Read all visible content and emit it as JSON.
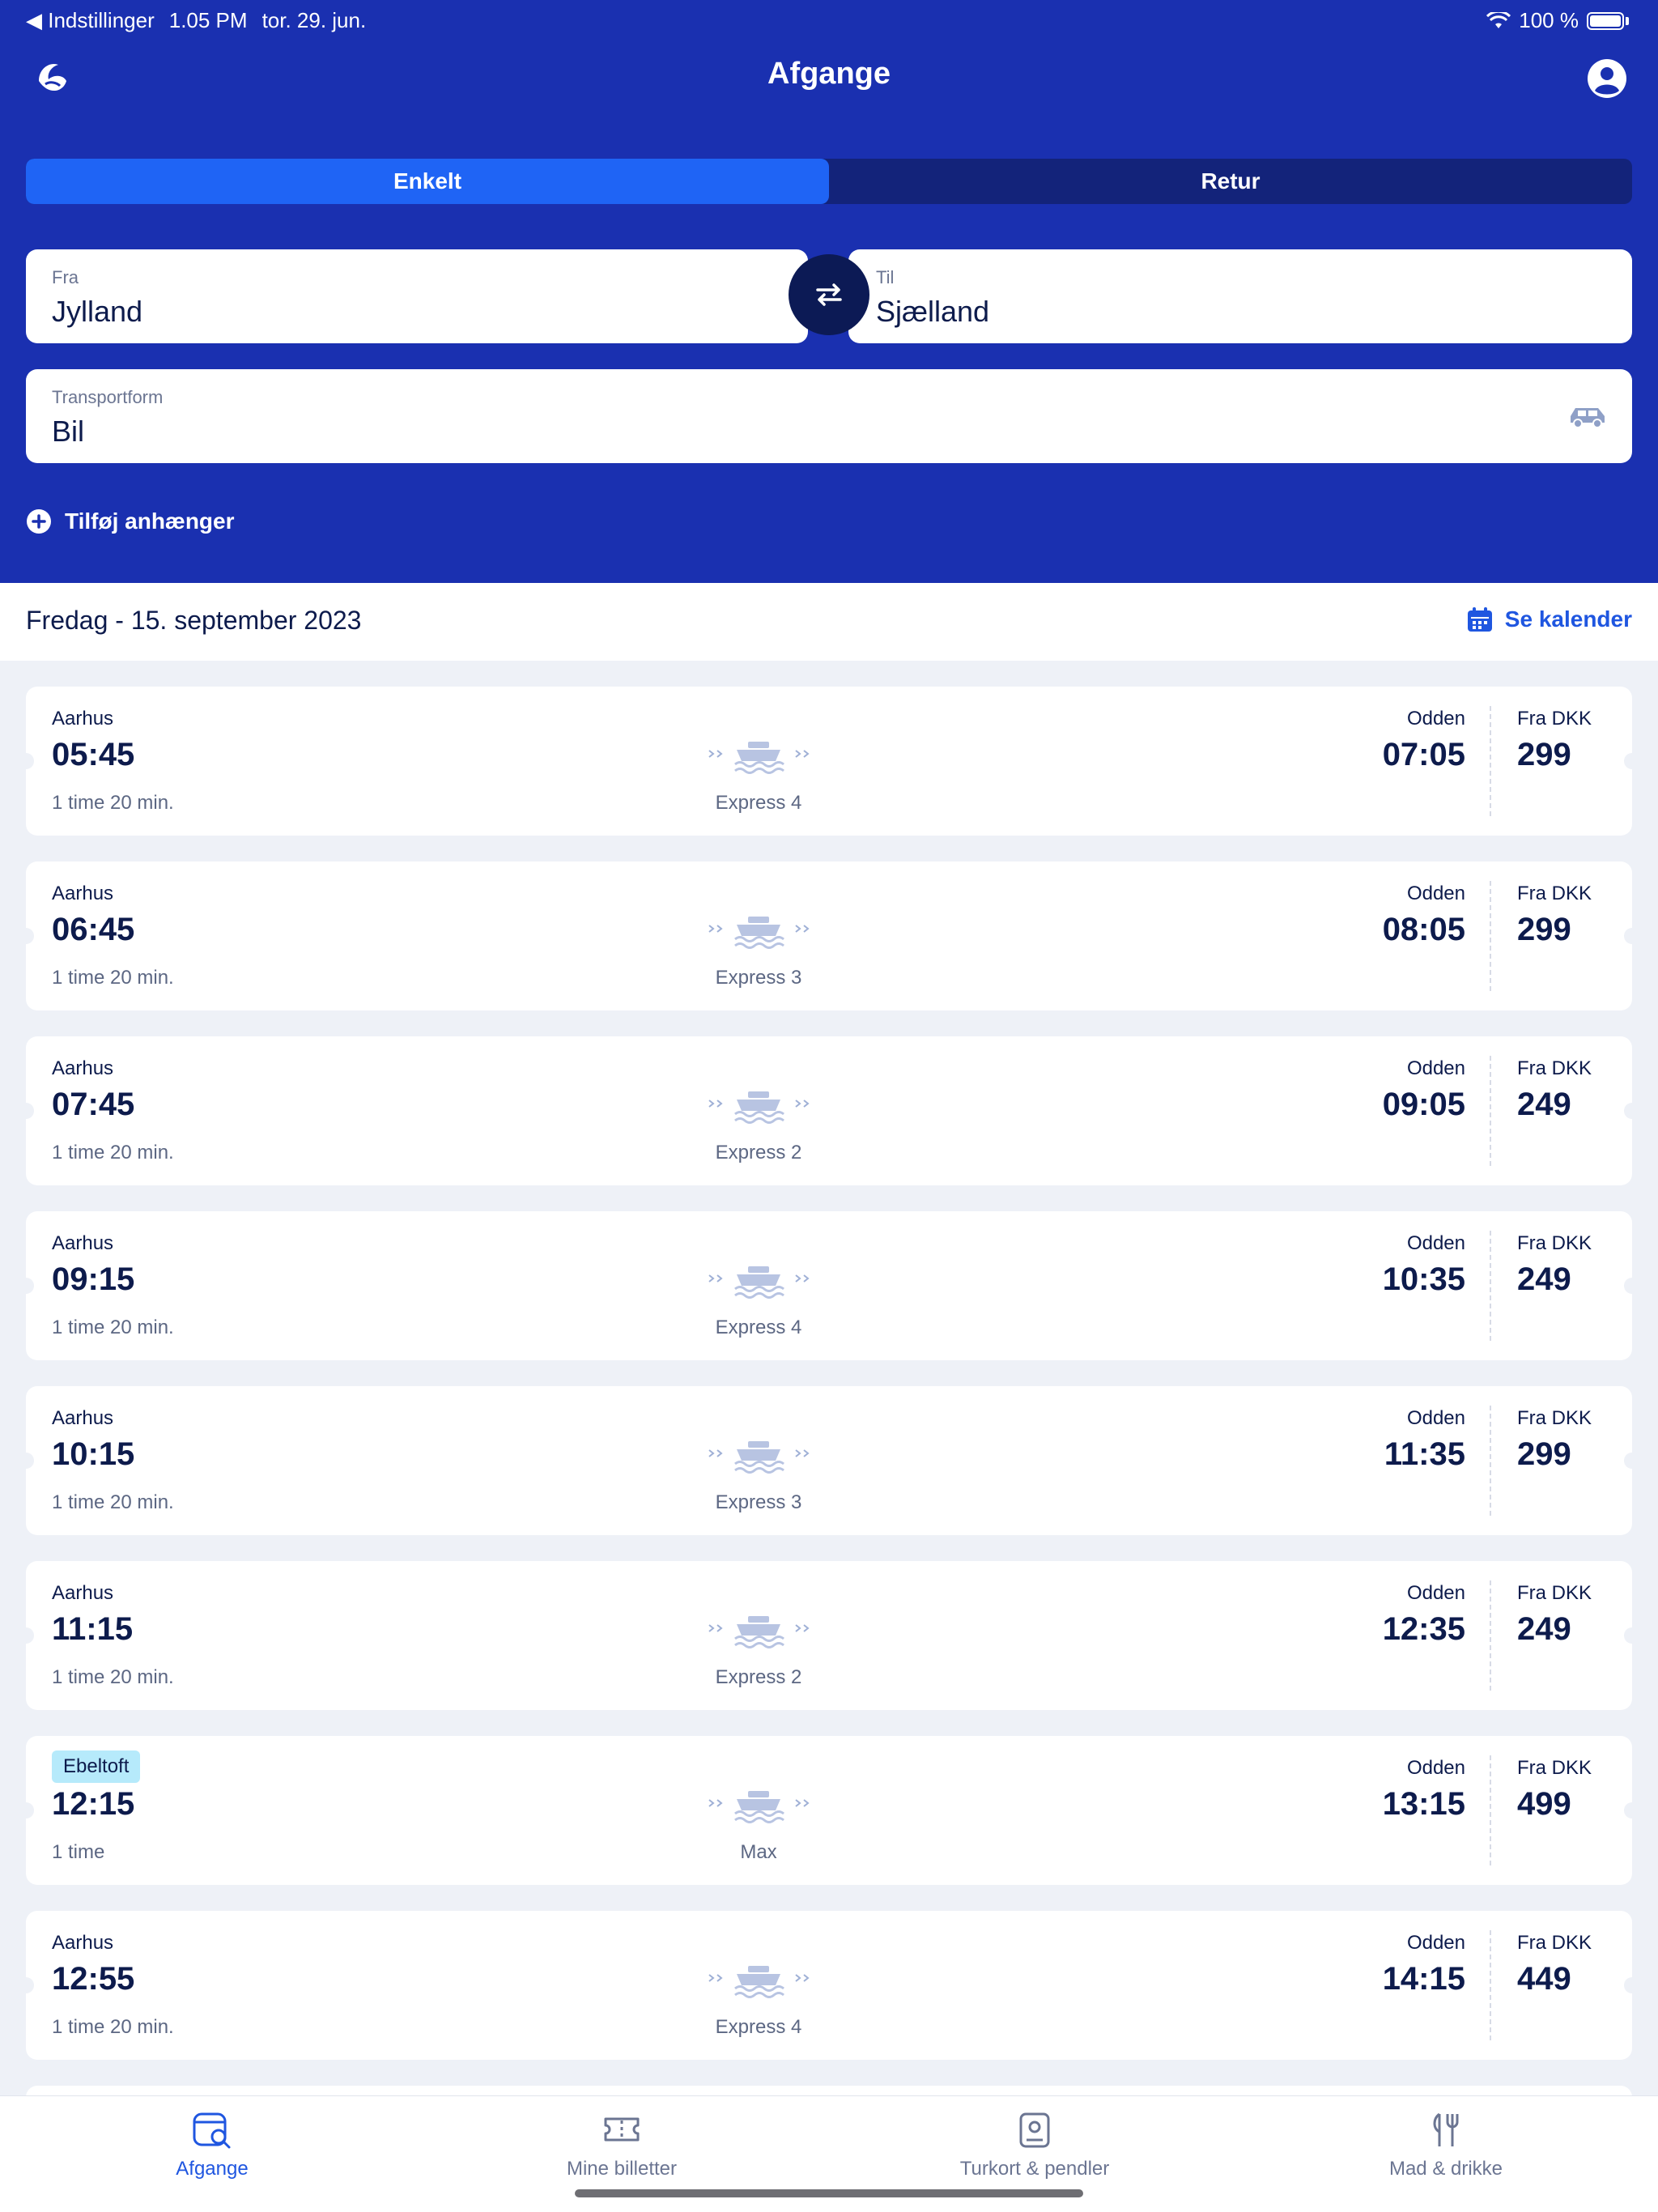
{
  "status": {
    "back_label": "◀ Indstillinger",
    "time": "1.05 PM",
    "date": "tor. 29. jun.",
    "battery": "100 %"
  },
  "header": {
    "title": "Afgange",
    "segments": [
      "Enkelt",
      "Retur"
    ],
    "from_label": "Fra",
    "from_value": "Jylland",
    "to_label": "Til",
    "to_value": "Sjælland",
    "transport_label": "Transportform",
    "transport_value": "Bil",
    "add_trailer": "Tilføj anhænger"
  },
  "date_bar": {
    "date": "Fredag - 15. september 2023",
    "calendar_link": "Se kalender"
  },
  "departures": [
    {
      "from": "Aarhus",
      "dep": "05:45",
      "duration": "1 time 20 min.",
      "vessel": "Express 4",
      "to": "Odden",
      "arr": "07:05",
      "price_label": "Fra DKK",
      "price": "299"
    },
    {
      "from": "Aarhus",
      "dep": "06:45",
      "duration": "1 time 20 min.",
      "vessel": "Express 3",
      "to": "Odden",
      "arr": "08:05",
      "price_label": "Fra DKK",
      "price": "299"
    },
    {
      "from": "Aarhus",
      "dep": "07:45",
      "duration": "1 time 20 min.",
      "vessel": "Express 2",
      "to": "Odden",
      "arr": "09:05",
      "price_label": "Fra DKK",
      "price": "249"
    },
    {
      "from": "Aarhus",
      "dep": "09:15",
      "duration": "1 time 20 min.",
      "vessel": "Express 4",
      "to": "Odden",
      "arr": "10:35",
      "price_label": "Fra DKK",
      "price": "249"
    },
    {
      "from": "Aarhus",
      "dep": "10:15",
      "duration": "1 time 20 min.",
      "vessel": "Express 3",
      "to": "Odden",
      "arr": "11:35",
      "price_label": "Fra DKK",
      "price": "299"
    },
    {
      "from": "Aarhus",
      "dep": "11:15",
      "duration": "1 time 20 min.",
      "vessel": "Express 2",
      "to": "Odden",
      "arr": "12:35",
      "price_label": "Fra DKK",
      "price": "249"
    },
    {
      "from": "Ebeltoft",
      "dep": "12:15",
      "duration": "1 time",
      "vessel": "Max",
      "to": "Odden",
      "arr": "13:15",
      "price_label": "Fra DKK",
      "price": "499"
    },
    {
      "from": "Aarhus",
      "dep": "12:55",
      "duration": "1 time 20 min.",
      "vessel": "Express 4",
      "to": "Odden",
      "arr": "14:15",
      "price_label": "Fra DKK",
      "price": "449"
    }
  ],
  "tabs": [
    "Afgange",
    "Mine billetter",
    "Turkort & pendler",
    "Mad & drikke"
  ],
  "colors": {
    "header": "#1a30b0",
    "accent": "#1f64f5",
    "tag": "#b6eafb"
  }
}
